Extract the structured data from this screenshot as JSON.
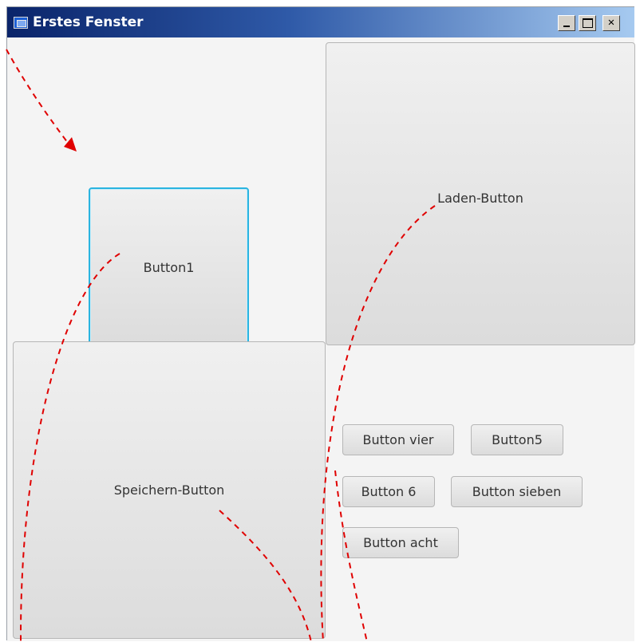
{
  "window": {
    "title": "Erstes Fenster",
    "controls": {
      "minimize": "_",
      "maximize": "□",
      "close": "×"
    }
  },
  "buttons": {
    "button1": "Button1",
    "laden": "Laden-Button",
    "speichern": "Speichern-Button",
    "vier": "Button vier",
    "fuenf": "Button5",
    "sechs": "Button 6",
    "sieben": "Button sieben",
    "acht": "Button acht"
  },
  "colors": {
    "titlebar_start": "#0a246a",
    "titlebar_end": "#a6caf0",
    "focus_ring": "#2ab4e0",
    "annotation": "#e00000"
  }
}
